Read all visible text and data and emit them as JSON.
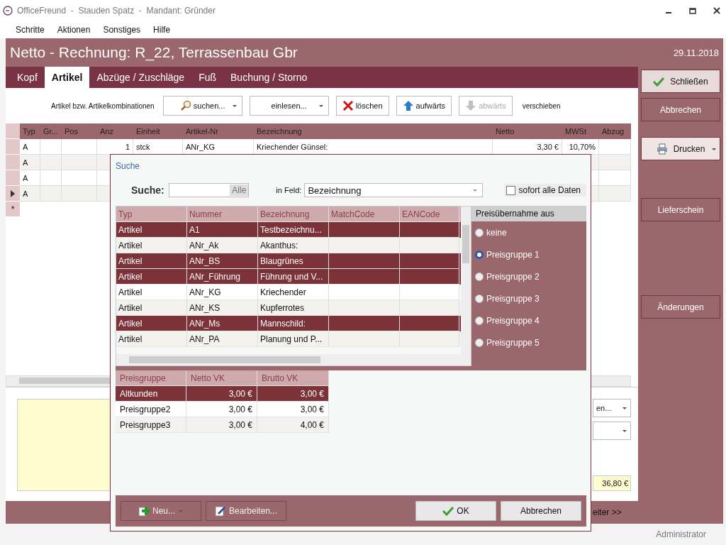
{
  "window": {
    "title": "OfficeFreund  -  Stauden Spatz  -  Mandant: Gründer"
  },
  "menu": [
    "Schritte",
    "Aktionen",
    "Sonstiges",
    "Hilfe"
  ],
  "header": {
    "title": "Netto - Rechnung: R_22, Terrassenbau Gbr",
    "date": "29.11.2018"
  },
  "tabs": [
    {
      "label": "Kopf",
      "selected": false
    },
    {
      "label": "Artikel",
      "selected": true
    },
    {
      "label": "Abzüge / Zuschläge",
      "selected": false
    },
    {
      "label": "Fuß",
      "selected": false
    },
    {
      "label": "Buchung / Storno",
      "selected": false
    }
  ],
  "toolbar": {
    "label": "Artikel bzw. Artikelkombinationen",
    "suffix": "verschieben",
    "buttons": [
      {
        "kind": "search",
        "label": "suchen...",
        "disabled": false
      },
      {
        "kind": "menu",
        "label": "einlesen...",
        "disabled": false
      },
      {
        "kind": "delete",
        "label": "löschen",
        "disabled": false
      },
      {
        "kind": "up",
        "label": "aufwärts",
        "disabled": false
      },
      {
        "kind": "down",
        "label": "abwärts",
        "disabled": true
      }
    ]
  },
  "grid": {
    "columns": [
      "Typ",
      "Gr...",
      "Pos",
      "Anz",
      "Einheit",
      "Artikel-Nr",
      "Bezeichnung",
      "Netto",
      "MWSt",
      "Abzug"
    ],
    "rows": [
      {
        "typ": "A",
        "anz": "1",
        "einheit": "stck",
        "artikel_nr": "ANr_KG",
        "bezeichnung": "Kriechender Günsel:",
        "netto": "3,30 €",
        "mwst": "10,70%",
        "current": false
      },
      {
        "typ": "A",
        "current": false
      },
      {
        "typ": "A",
        "current": false
      },
      {
        "typ": "A",
        "current": true
      }
    ],
    "new_row_marker": "*"
  },
  "sidebar": {
    "buttons": [
      {
        "kind": "confirm",
        "label": "Schließen"
      },
      {
        "kind": "plain",
        "label": "Abbrechen"
      },
      {
        "kind": "print",
        "label": "Drucken"
      },
      {
        "kind": "plain",
        "label": "Lieferschein"
      },
      {
        "kind": "plain",
        "label": "Änderungen"
      }
    ]
  },
  "lower": {
    "dropdown_text": "en...",
    "total": "36,80 €",
    "next_link": "eiter >>"
  },
  "status_bar": {
    "user": "Administrator"
  },
  "dialog": {
    "title": "Suche",
    "search_label": "Suche:",
    "search_button": "Alle",
    "field_label": "in Feld:",
    "field_value": "Bezeichnung",
    "instant": {
      "label": "sofort alle Daten",
      "checked": false
    },
    "results": {
      "columns": [
        "Typ",
        "Nummer",
        "Bezeichnung",
        "MatchCode",
        "EANCode"
      ],
      "rows": [
        {
          "cells": [
            "Artikel",
            "A1",
            "Testbezeichnu..."
          ],
          "selected": true
        },
        {
          "cells": [
            "Artikel",
            "ANr_Ak",
            "Akanthus:"
          ],
          "selected": false
        },
        {
          "cells": [
            "Artikel",
            "ANr_BS",
            "Blaugrünes"
          ],
          "selected": true
        },
        {
          "cells": [
            "Artikel",
            "ANr_Führung",
            "Führung und V..."
          ],
          "selected": true
        },
        {
          "cells": [
            "Artikel",
            "ANr_KG",
            "Kriechender"
          ],
          "selected": false
        },
        {
          "cells": [
            "Artikel",
            "ANr_KS",
            "Kupferrotes"
          ],
          "selected": false
        },
        {
          "cells": [
            "Artikel",
            "ANr_Ms",
            "Mannschild:"
          ],
          "selected": true
        },
        {
          "cells": [
            "Artikel",
            "ANr_PA",
            "Planung  und P..."
          ],
          "selected": false
        }
      ]
    },
    "price_source": {
      "title": "Preisübernahme aus",
      "options": [
        {
          "label": "keine",
          "selected": false
        },
        {
          "label": "Preisgruppe 1",
          "selected": true
        },
        {
          "label": "Preisgruppe 2",
          "selected": false
        },
        {
          "label": "Preisgruppe 3",
          "selected": false
        },
        {
          "label": "Preisgruppe 4",
          "selected": false
        },
        {
          "label": "Preisgruppe 5",
          "selected": false
        }
      ]
    },
    "prices": {
      "columns": [
        "Preisgruppe",
        "Netto VK",
        "Brutto VK"
      ],
      "rows": [
        {
          "cells": [
            "Altkunden",
            "3,00 €",
            "3,00 €"
          ],
          "selected": true
        },
        {
          "cells": [
            "Preisgruppe2",
            "3,00 €",
            "3,00 €"
          ],
          "selected": false
        },
        {
          "cells": [
            "Preisgruppe3",
            "3,00 €",
            "4,00 €"
          ],
          "selected": false
        }
      ]
    },
    "footer_buttons": [
      {
        "kind": "new",
        "label": "Neu..."
      },
      {
        "kind": "edit",
        "label": "Bearbeiten..."
      },
      {
        "kind": "ok",
        "label": "OK"
      },
      {
        "kind": "cancel",
        "label": "Abbrechen"
      }
    ]
  }
}
